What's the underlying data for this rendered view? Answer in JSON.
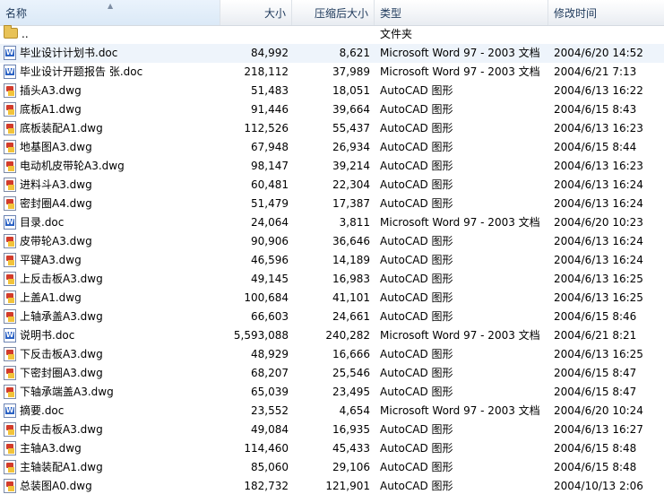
{
  "columns": {
    "name": "名称",
    "size": "大小",
    "compressed": "压缩后大小",
    "type": "类型",
    "modified": "修改时间"
  },
  "files": [
    {
      "icon": "folder-icon",
      "name": "..",
      "size": "",
      "compressed": "",
      "type": "文件夹",
      "modified": ""
    },
    {
      "icon": "word-doc-icon",
      "name": "毕业设计计划书.doc",
      "size": "84,992",
      "compressed": "8,621",
      "type": "Microsoft Word 97 - 2003 文档",
      "modified": "2004/6/20 14:52"
    },
    {
      "icon": "word-doc-icon",
      "name": "毕业设计开题报告 张.doc",
      "size": "218,112",
      "compressed": "37,989",
      "type": "Microsoft Word 97 - 2003 文档",
      "modified": "2004/6/21 7:13"
    },
    {
      "icon": "autocad-dwg-icon",
      "name": "插头A3.dwg",
      "size": "51,483",
      "compressed": "18,051",
      "type": "AutoCAD 图形",
      "modified": "2004/6/13 16:22"
    },
    {
      "icon": "autocad-dwg-icon",
      "name": "底板A1.dwg",
      "size": "91,446",
      "compressed": "39,664",
      "type": "AutoCAD 图形",
      "modified": "2004/6/15 8:43"
    },
    {
      "icon": "autocad-dwg-icon",
      "name": "底板装配A1.dwg",
      "size": "112,526",
      "compressed": "55,437",
      "type": "AutoCAD 图形",
      "modified": "2004/6/13 16:23"
    },
    {
      "icon": "autocad-dwg-icon",
      "name": "地基图A3.dwg",
      "size": "67,948",
      "compressed": "26,934",
      "type": "AutoCAD 图形",
      "modified": "2004/6/15 8:44"
    },
    {
      "icon": "autocad-dwg-icon",
      "name": "电动机皮带轮A3.dwg",
      "size": "98,147",
      "compressed": "39,214",
      "type": "AutoCAD 图形",
      "modified": "2004/6/13 16:23"
    },
    {
      "icon": "autocad-dwg-icon",
      "name": "进料斗A3.dwg",
      "size": "60,481",
      "compressed": "22,304",
      "type": "AutoCAD 图形",
      "modified": "2004/6/13 16:24"
    },
    {
      "icon": "autocad-dwg-icon",
      "name": "密封圈A4.dwg",
      "size": "51,479",
      "compressed": "17,387",
      "type": "AutoCAD 图形",
      "modified": "2004/6/13 16:24"
    },
    {
      "icon": "word-doc-icon",
      "name": "目录.doc",
      "size": "24,064",
      "compressed": "3,811",
      "type": "Microsoft Word 97 - 2003 文档",
      "modified": "2004/6/20 10:23"
    },
    {
      "icon": "autocad-dwg-icon",
      "name": "皮带轮A3.dwg",
      "size": "90,906",
      "compressed": "36,646",
      "type": "AutoCAD 图形",
      "modified": "2004/6/13 16:24"
    },
    {
      "icon": "autocad-dwg-icon",
      "name": "平键A3.dwg",
      "size": "46,596",
      "compressed": "14,189",
      "type": "AutoCAD 图形",
      "modified": "2004/6/13 16:24"
    },
    {
      "icon": "autocad-dwg-icon",
      "name": "上反击板A3.dwg",
      "size": "49,145",
      "compressed": "16,983",
      "type": "AutoCAD 图形",
      "modified": "2004/6/13 16:25"
    },
    {
      "icon": "autocad-dwg-icon",
      "name": "上盖A1.dwg",
      "size": "100,684",
      "compressed": "41,101",
      "type": "AutoCAD 图形",
      "modified": "2004/6/13 16:25"
    },
    {
      "icon": "autocad-dwg-icon",
      "name": "上轴承盖A3.dwg",
      "size": "66,603",
      "compressed": "24,661",
      "type": "AutoCAD 图形",
      "modified": "2004/6/15 8:46"
    },
    {
      "icon": "word-doc-icon",
      "name": "说明书.doc",
      "size": "5,593,088",
      "compressed": "240,282",
      "type": "Microsoft Word 97 - 2003 文档",
      "modified": "2004/6/21 8:21"
    },
    {
      "icon": "autocad-dwg-icon",
      "name": "下反击板A3.dwg",
      "size": "48,929",
      "compressed": "16,666",
      "type": "AutoCAD 图形",
      "modified": "2004/6/13 16:25"
    },
    {
      "icon": "autocad-dwg-icon",
      "name": "下密封圈A3.dwg",
      "size": "68,207",
      "compressed": "25,546",
      "type": "AutoCAD 图形",
      "modified": "2004/6/15 8:47"
    },
    {
      "icon": "autocad-dwg-icon",
      "name": "下轴承端盖A3.dwg",
      "size": "65,039",
      "compressed": "23,495",
      "type": "AutoCAD 图形",
      "modified": "2004/6/15 8:47"
    },
    {
      "icon": "word-doc-icon",
      "name": "摘要.doc",
      "size": "23,552",
      "compressed": "4,654",
      "type": "Microsoft Word 97 - 2003 文档",
      "modified": "2004/6/20 10:24"
    },
    {
      "icon": "autocad-dwg-icon",
      "name": "中反击板A3.dwg",
      "size": "49,084",
      "compressed": "16,935",
      "type": "AutoCAD 图形",
      "modified": "2004/6/13 16:27"
    },
    {
      "icon": "autocad-dwg-icon",
      "name": "主轴A3.dwg",
      "size": "114,460",
      "compressed": "45,433",
      "type": "AutoCAD 图形",
      "modified": "2004/6/15 8:48"
    },
    {
      "icon": "autocad-dwg-icon",
      "name": "主轴装配A1.dwg",
      "size": "85,060",
      "compressed": "29,106",
      "type": "AutoCAD 图形",
      "modified": "2004/6/15 8:48"
    },
    {
      "icon": "autocad-dwg-icon",
      "name": "总装图A0.dwg",
      "size": "182,732",
      "compressed": "121,901",
      "type": "AutoCAD 图形",
      "modified": "2004/10/13 2:06"
    }
  ]
}
